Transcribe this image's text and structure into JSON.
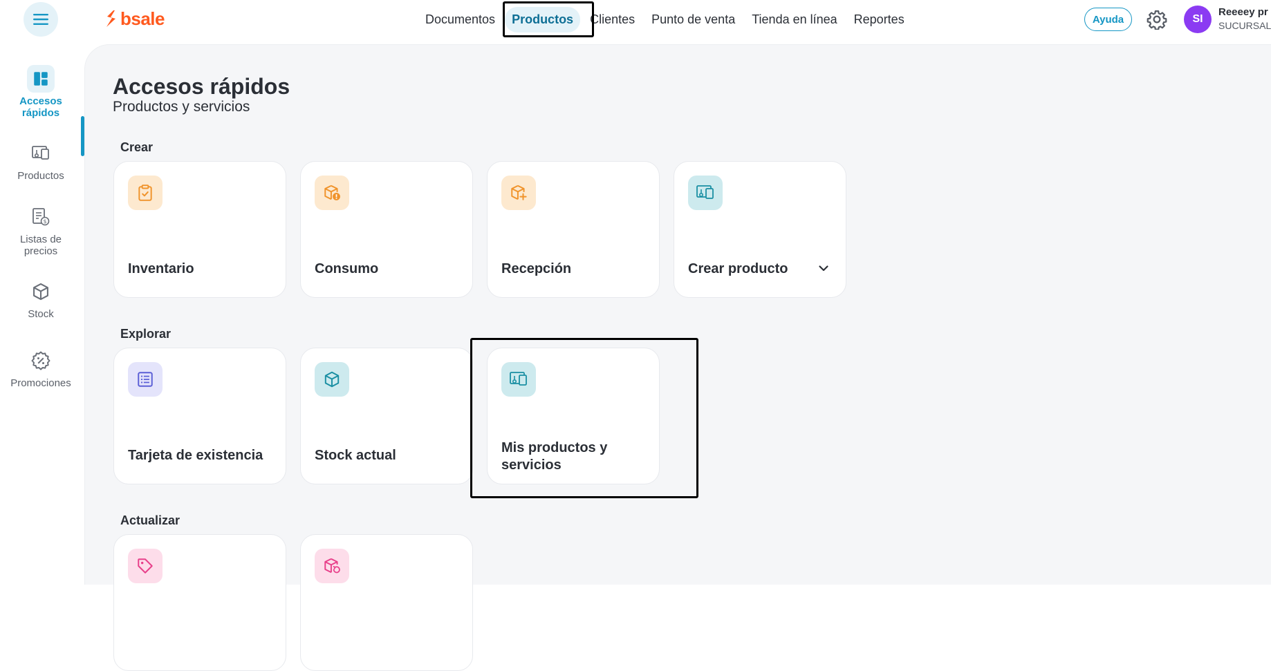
{
  "app": {
    "logo_text": "bsale"
  },
  "nav": {
    "items": [
      {
        "label": "Documentos"
      },
      {
        "label": "Productos"
      },
      {
        "label": "Clientes"
      },
      {
        "label": "Punto de venta"
      },
      {
        "label": "Tienda en línea"
      },
      {
        "label": "Reportes"
      }
    ],
    "active_index": 1
  },
  "header": {
    "help_label": "Ayuda",
    "avatar_initials": "SI",
    "user_name": "Reeeey pr",
    "user_branch": "SUCURSAL"
  },
  "sidebar": {
    "items": [
      {
        "label_line1": "Accesos",
        "label_line2": "rápidos",
        "icon": "dashboard-icon"
      },
      {
        "label_line1": "Productos",
        "label_line2": "",
        "icon": "product-icon"
      },
      {
        "label_line1": "Listas de",
        "label_line2": "precios",
        "icon": "price-list-icon"
      },
      {
        "label_line1": "Stock",
        "label_line2": "",
        "icon": "box-icon"
      },
      {
        "label_line1": "Promociones",
        "label_line2": "",
        "icon": "promotion-icon"
      }
    ],
    "active_index": 0
  },
  "page": {
    "title": "Accesos rápidos",
    "subtitle": "Productos y servicios"
  },
  "sections": {
    "crear": {
      "label": "Crear",
      "cards": [
        {
          "label": "Inventario",
          "icon": "clipboard-check-icon",
          "color": "#f0932b"
        },
        {
          "label": "Consumo",
          "icon": "box-alert-icon",
          "color": "#f0932b"
        },
        {
          "label": "Recepción",
          "icon": "box-plus-icon",
          "color": "#f0932b"
        },
        {
          "label": "Crear producto",
          "icon": "product-icon",
          "color": "#1a8fa3"
        }
      ]
    },
    "explorar": {
      "label": "Explorar",
      "cards": [
        {
          "label": "Tarjeta de existencia",
          "icon": "list-icon",
          "color": "#5b5fd6"
        },
        {
          "label": "Stock actual",
          "icon": "box-icon",
          "color": "#1a8fa3"
        },
        {
          "label": "Mis productos y servicios",
          "icon": "product-icon",
          "color": "#1a8fa3"
        }
      ]
    },
    "actualizar": {
      "label": "Actualizar",
      "cards": [
        {
          "label": "",
          "icon": "tag-icon",
          "color": "#e8408a"
        },
        {
          "label": "",
          "icon": "box-refresh-icon",
          "color": "#e8408a"
        }
      ]
    }
  },
  "colors": {
    "accent": "#1596c4",
    "brand": "#ff5a1f",
    "avatar": "#8b3bf2"
  }
}
